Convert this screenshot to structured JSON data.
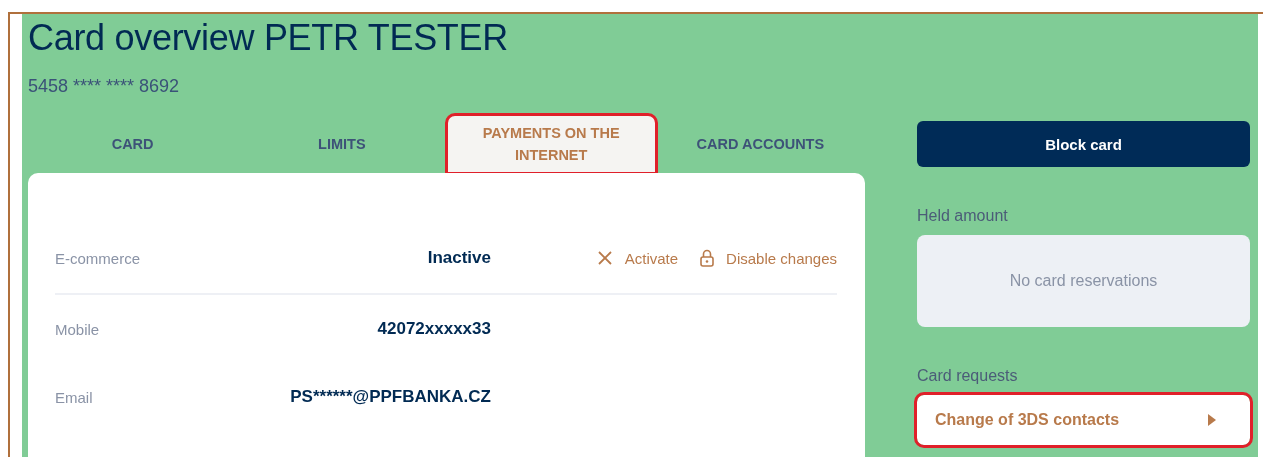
{
  "header": {
    "title": "Card overview PETR TESTER",
    "card_number": "5458 **** **** 8692"
  },
  "tabs": [
    {
      "label": "CARD",
      "selected": false,
      "highlighted": false
    },
    {
      "label": "LIMITS",
      "selected": false,
      "highlighted": false
    },
    {
      "label": "PAYMENTS ON THE INTERNET",
      "selected": true,
      "highlighted": true
    },
    {
      "label": "CARD ACCOUNTS",
      "selected": false,
      "highlighted": false
    }
  ],
  "settings": [
    {
      "label": "E-commerce",
      "value": "Inactive",
      "actions": [
        {
          "kind": "close",
          "label": "Activate"
        },
        {
          "kind": "lock",
          "label": "Disable changes"
        }
      ],
      "divider_after": true
    },
    {
      "label": "Mobile",
      "value": "42072xxxxx33",
      "divider_after": false
    },
    {
      "label": "Email",
      "value": "PS******@PPFBANKA.CZ",
      "divider_after": false
    }
  ],
  "sidebar": {
    "block_button": "Block card",
    "held_amount": {
      "heading": "Held amount",
      "empty_text": "No card reservations"
    },
    "card_requests": {
      "heading": "Card requests",
      "items": [
        {
          "label": "Change of 3DS contacts",
          "highlighted": true
        }
      ]
    }
  }
}
